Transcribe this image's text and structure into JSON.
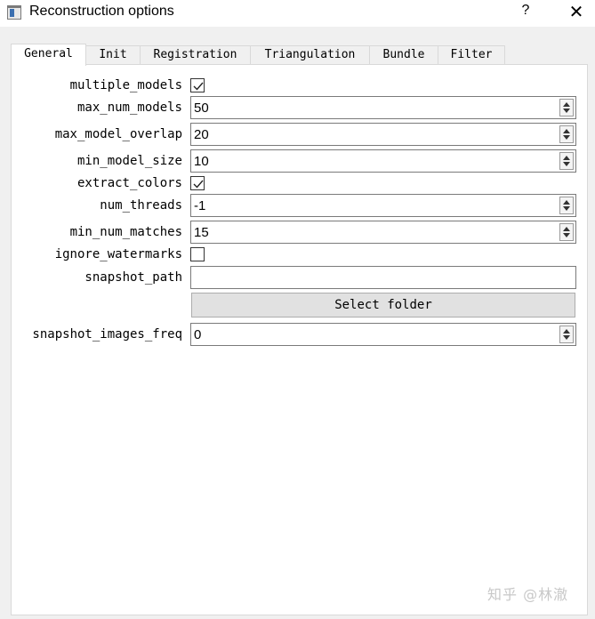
{
  "window": {
    "title": "Reconstruction options",
    "help_label": "?",
    "close_label": "✕",
    "icon": "app-window-icon"
  },
  "tabs": [
    {
      "label": "General",
      "active": true
    },
    {
      "label": "Init",
      "active": false
    },
    {
      "label": "Registration",
      "active": false
    },
    {
      "label": "Triangulation",
      "active": false
    },
    {
      "label": "Bundle",
      "active": false
    },
    {
      "label": "Filter",
      "active": false
    }
  ],
  "options": {
    "multiple_models": {
      "label": "multiple_models",
      "checked": true
    },
    "max_num_models": {
      "label": "max_num_models",
      "value": "50"
    },
    "max_model_overlap": {
      "label": "max_model_overlap",
      "value": "20"
    },
    "min_model_size": {
      "label": "min_model_size",
      "value": "10"
    },
    "extract_colors": {
      "label": "extract_colors",
      "checked": true
    },
    "num_threads": {
      "label": "num_threads",
      "value": "-1"
    },
    "min_num_matches": {
      "label": "min_num_matches",
      "value": "15"
    },
    "ignore_watermarks": {
      "label": "ignore_watermarks",
      "checked": false
    },
    "snapshot_path": {
      "label": "snapshot_path",
      "value": ""
    },
    "select_folder": {
      "label": "Select folder"
    },
    "snapshot_images_freq": {
      "label": "snapshot_images_freq",
      "value": "0"
    }
  },
  "watermark": "知乎 @林澈"
}
